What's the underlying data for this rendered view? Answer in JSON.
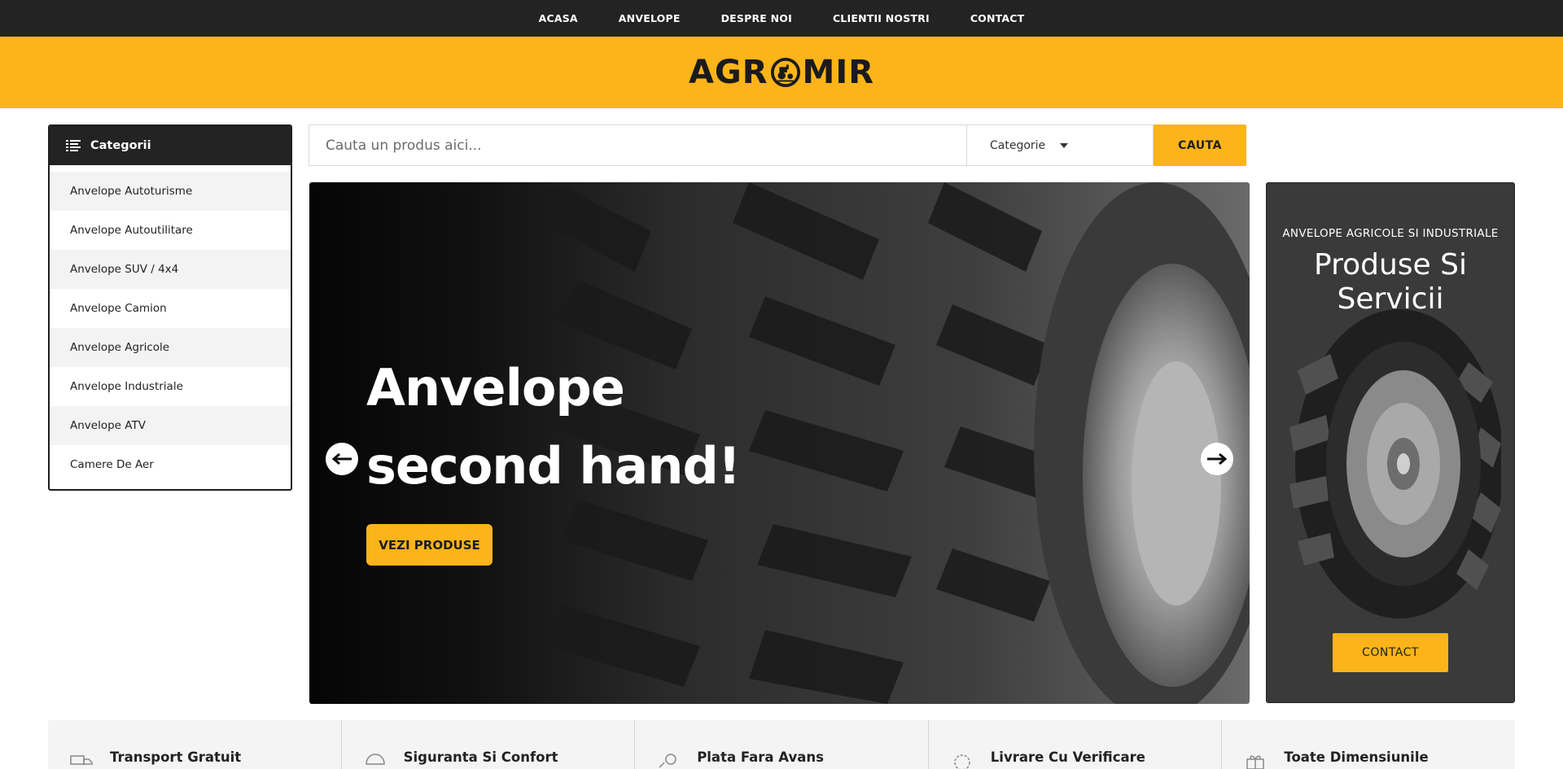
{
  "nav": {
    "items": [
      {
        "label": "ACASA"
      },
      {
        "label": "ANVELOPE"
      },
      {
        "label": "DESPRE NOI"
      },
      {
        "label": "CLIENTII NOSTRI"
      },
      {
        "label": "CONTACT"
      }
    ]
  },
  "brand": {
    "logo_left": "AGR",
    "logo_right": "MIR",
    "accent": "#fbb419",
    "dark": "#232323"
  },
  "sidebar": {
    "title": "Categorii",
    "icon": "list-icon",
    "items": [
      {
        "label": "Anvelope Autoturisme"
      },
      {
        "label": "Anvelope Autoutilitare"
      },
      {
        "label": "Anvelope SUV / 4x4"
      },
      {
        "label": "Anvelope Camion"
      },
      {
        "label": "Anvelope Agricole"
      },
      {
        "label": "Anvelope Industriale"
      },
      {
        "label": "Anvelope ATV"
      },
      {
        "label": "Camere De Aer"
      }
    ]
  },
  "search": {
    "placeholder": "Cauta un produs aici...",
    "category_label": "Categorie",
    "button_label": "CAUTA"
  },
  "hero": {
    "title_line1": "Anvelope",
    "title_line2": "second hand!",
    "button_label": "VEZI PRODUSE",
    "prev_icon": "arrow-left-icon",
    "next_icon": "arrow-right-icon"
  },
  "promo": {
    "subtitle": "ANVELOPE AGRICOLE SI INDUSTRIALE",
    "title_line1": "Produse Si",
    "title_line2": "Servicii",
    "button_label": "CONTACT"
  },
  "features": [
    {
      "label": "Transport Gratuit",
      "icon": "truck-icon"
    },
    {
      "label": "Siguranta Si Confort",
      "icon": "shield-icon"
    },
    {
      "label": "Plata Fara Avans",
      "icon": "wallet-icon"
    },
    {
      "label": "Livrare Cu Verificare",
      "icon": "check-delivery-icon"
    },
    {
      "label": "Toate Dimensiunile",
      "icon": "gift-icon"
    }
  ]
}
